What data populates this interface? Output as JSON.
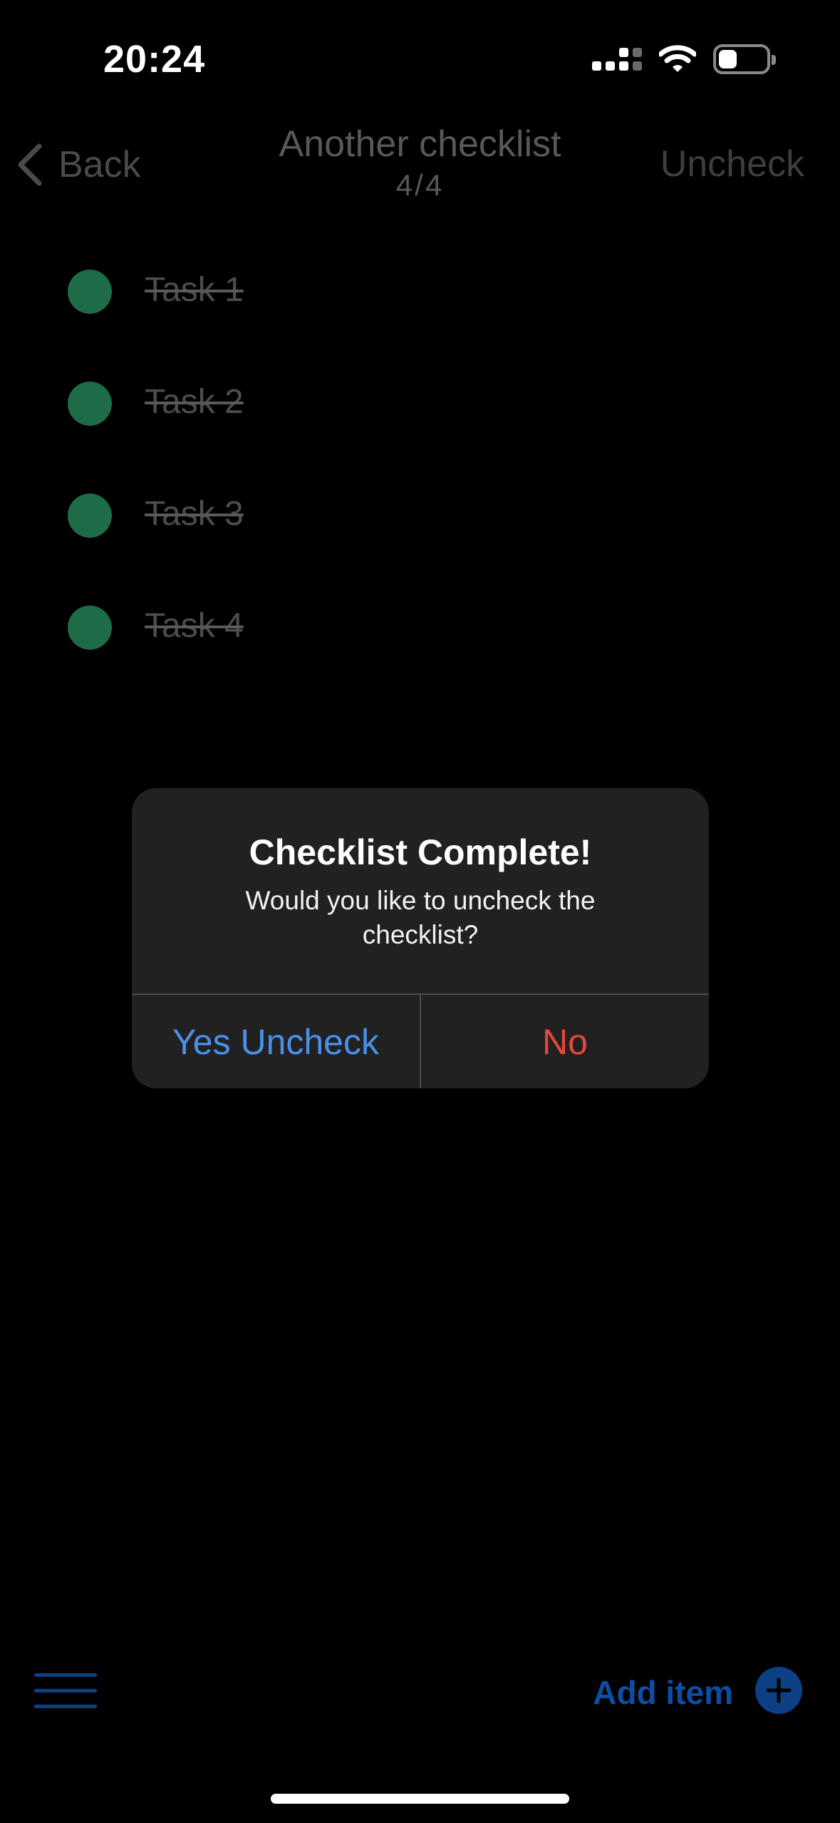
{
  "status_bar": {
    "time": "20:24",
    "battery_level": 0.25
  },
  "nav": {
    "back_label": "Back",
    "title": "Another checklist",
    "count": "4/4",
    "action_label": "Uncheck"
  },
  "tasks": [
    {
      "label": "Task 1",
      "checked": true
    },
    {
      "label": "Task 2",
      "checked": true
    },
    {
      "label": "Task 3",
      "checked": true
    },
    {
      "label": "Task 4",
      "checked": true
    }
  ],
  "alert": {
    "title": "Checklist Complete!",
    "message": "Would you like to uncheck the checklist?",
    "confirm_label": "Yes Uncheck",
    "cancel_label": "No"
  },
  "toolbar": {
    "add_label": "Add item"
  },
  "colors": {
    "background": "#000000",
    "check_green": "#1d6b47",
    "alert_confirm": "#4a90e8",
    "alert_cancel": "#e2483b",
    "accent_blue": "#0c3f83"
  }
}
